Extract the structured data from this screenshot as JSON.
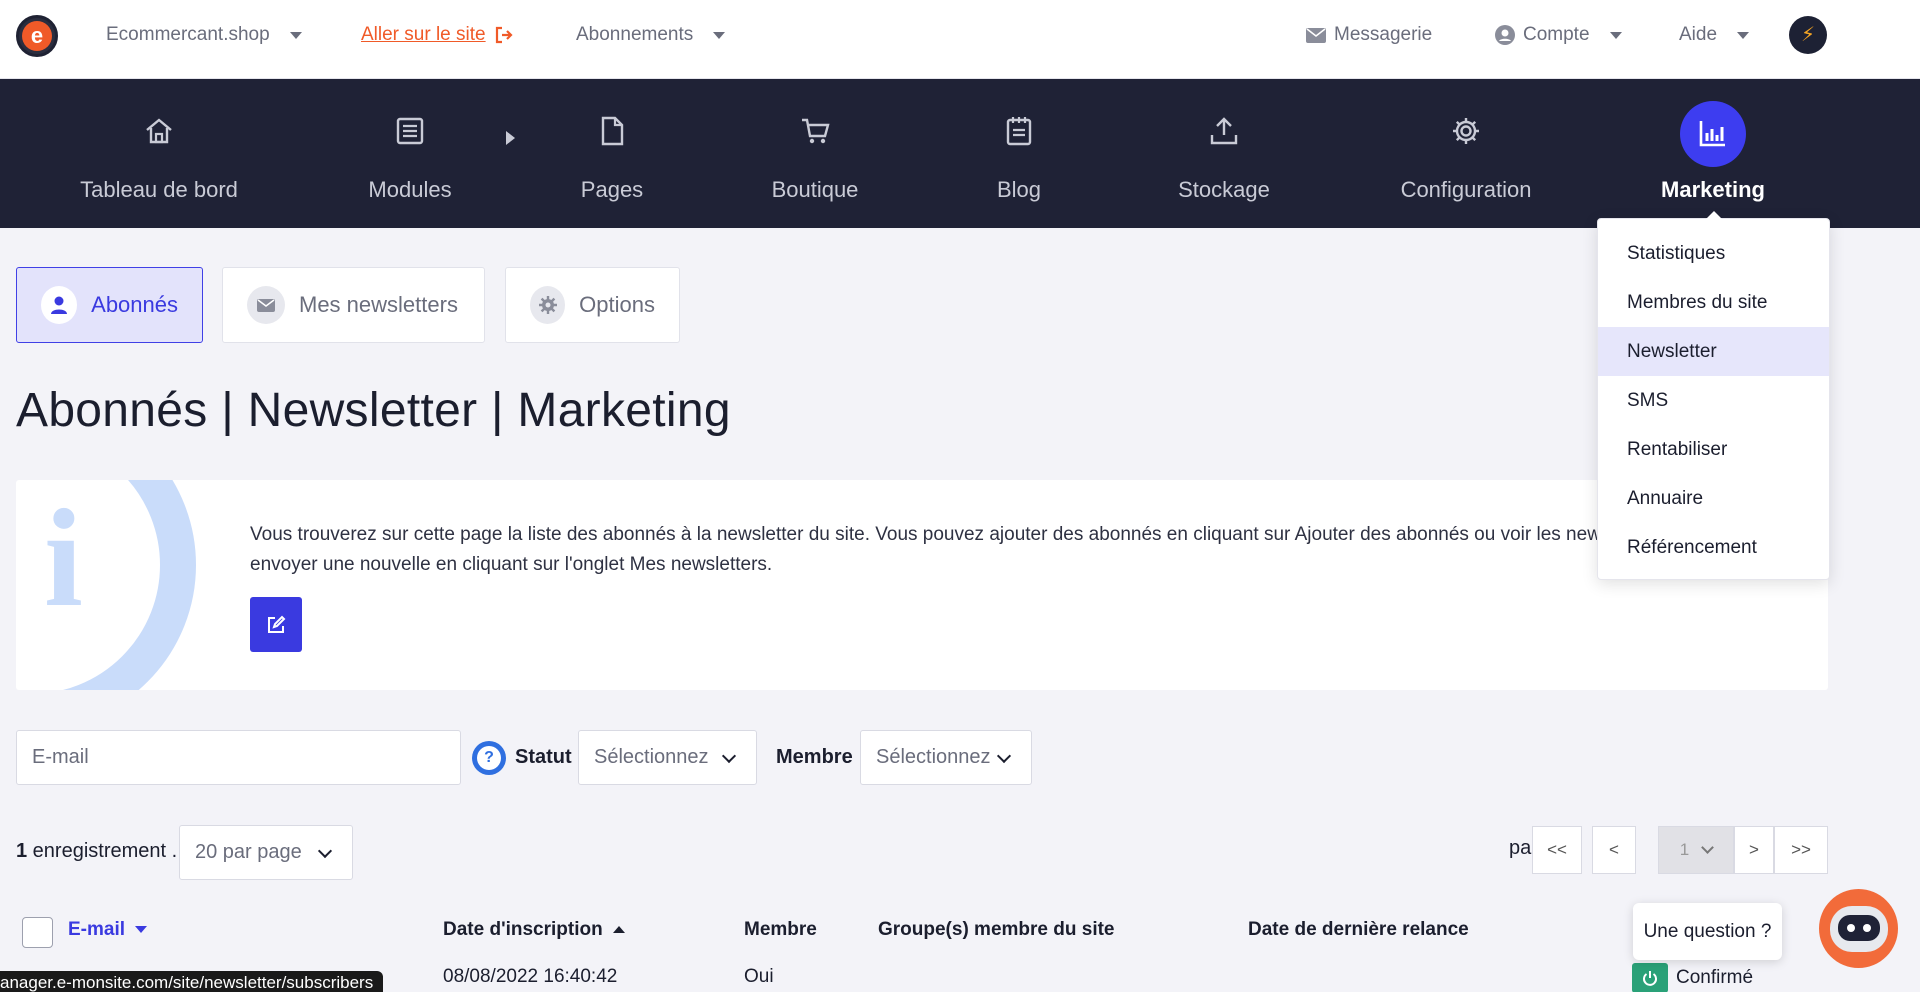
{
  "topbar": {
    "site_name": "Ecommercant.shop",
    "visit_site": "Aller sur le site",
    "subscriptions": "Abonnements",
    "messages": "Messagerie",
    "account": "Compte",
    "help": "Aide"
  },
  "nav": {
    "items": [
      {
        "label": "Tableau de bord",
        "icon": "home-icon"
      },
      {
        "label": "Modules",
        "icon": "list-icon"
      },
      {
        "label": "Pages",
        "icon": "page-icon"
      },
      {
        "label": "Boutique",
        "icon": "cart-icon"
      },
      {
        "label": "Blog",
        "icon": "notepad-icon"
      },
      {
        "label": "Stockage",
        "icon": "upload-icon"
      },
      {
        "label": "Configuration",
        "icon": "gear-icon"
      },
      {
        "label": "Marketing",
        "icon": "bar-chart-icon"
      }
    ],
    "active": "Marketing"
  },
  "subtabs": {
    "subscribers": "Abonnés",
    "my_newsletters": "Mes newsletters",
    "options": "Options"
  },
  "page_title": "Abonnés | Newsletter | Marketing",
  "info": {
    "text": "Vous trouverez sur cette page la liste des abonnés à la newsletter du site. Vous pouvez ajouter des abonnés en cliquant sur Ajouter des abonnés ou voir les newsletters envoyées et en envoyer une nouvelle en cliquant sur l'onglet Mes newsletters."
  },
  "filters": {
    "email_placeholder": "E-mail",
    "status_label": "Statut",
    "status_value": "Sélectionnez",
    "member_label": "Membre",
    "member_value": "Sélectionnez"
  },
  "records": {
    "count": "1",
    "suffix": " enregistrement .",
    "per_page": "20 par page"
  },
  "pager": {
    "label": "page :",
    "first": "<<",
    "prev": "<",
    "current": "1",
    "next": ">",
    "last": ">>"
  },
  "table": {
    "headers": {
      "email": "E-mail",
      "signup_date": "Date d'inscription",
      "member": "Membre",
      "groups": "Groupe(s) membre du site",
      "last_reminder": "Date de dernière relance"
    },
    "rows": [
      {
        "signup_date": "08/08/2022 16:40:42",
        "member": "Oui",
        "status": "Confirmé"
      }
    ]
  },
  "marketing_menu": {
    "items": [
      "Statistiques",
      "Membres du site",
      "Newsletter",
      "SMS",
      "Rentabiliser",
      "Annuaire",
      "Référencement"
    ],
    "selected": "Newsletter"
  },
  "chat": {
    "question": "Une question ?"
  },
  "status_url": "anager.e-monsite.com/site/newsletter/subscribers",
  "colors": {
    "accent": "#3a3ae0",
    "brand_orange": "#f05a28",
    "nav_bg": "#1f2236",
    "success": "#2aa178"
  }
}
